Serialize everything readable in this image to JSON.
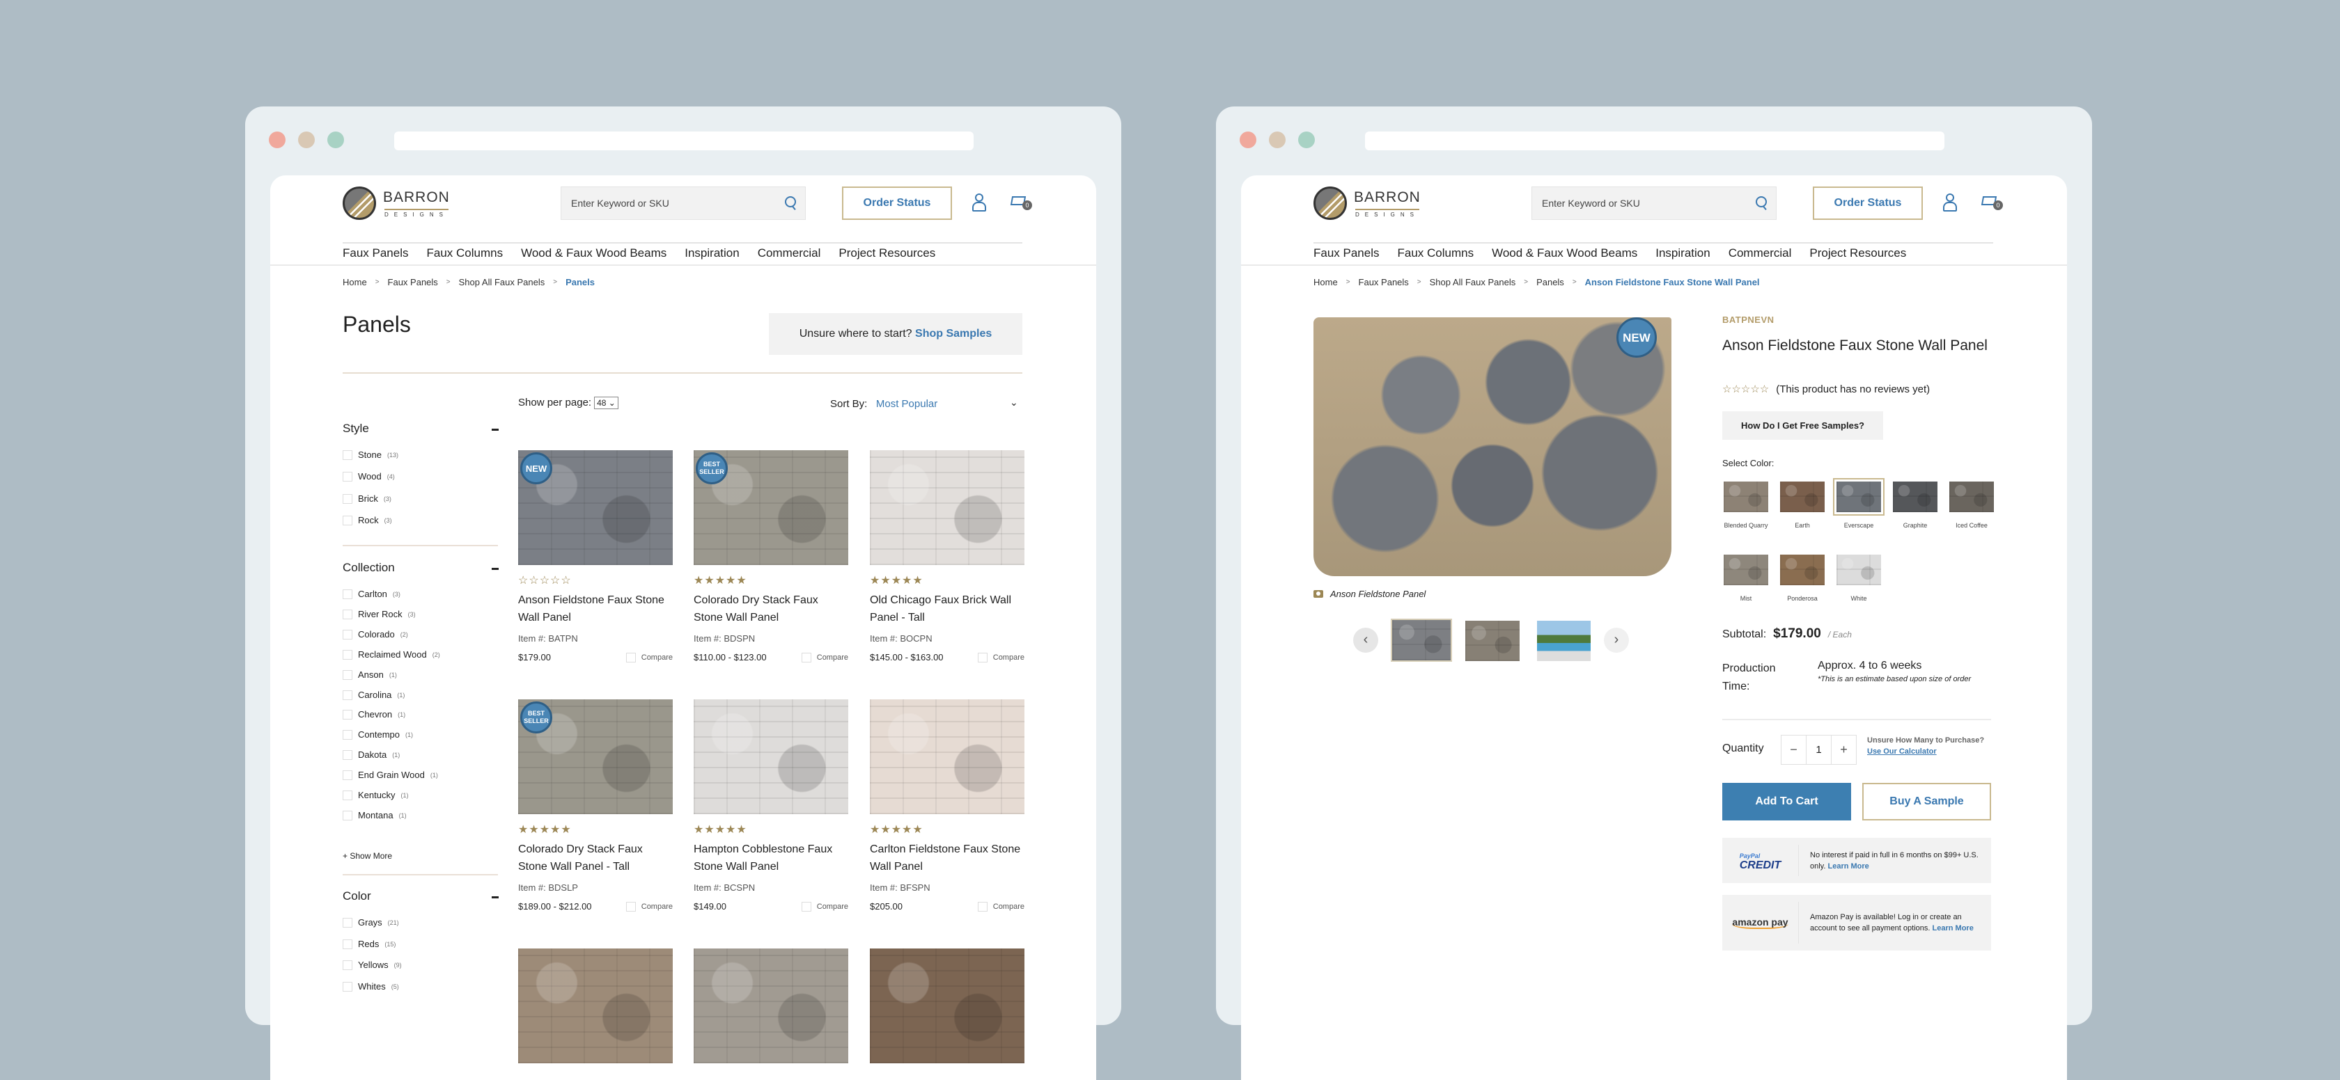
{
  "header": {
    "brand": "BARRON",
    "brand_sub": "DESIGNS",
    "search_placeholder": "Enter Keyword or SKU",
    "order_status": "Order Status",
    "cart_count": "0",
    "nav": [
      "Faux Panels",
      "Faux Columns",
      "Wood & Faux Wood Beams",
      "Inspiration",
      "Commercial",
      "Project Resources"
    ]
  },
  "listing": {
    "breadcrumb": [
      "Home",
      "Faux Panels",
      "Shop All Faux Panels",
      "Panels"
    ],
    "title": "Panels",
    "samples_prompt": "Unsure where to start?",
    "samples_link": "Shop Samples",
    "per_page_label": "Show per page:",
    "per_page_value": "48",
    "sort_label": "Sort By:",
    "sort_value": "Most Popular",
    "filters": [
      {
        "title": "Style",
        "items": [
          {
            "label": "Stone",
            "count": "(13)"
          },
          {
            "label": "Wood",
            "count": "(4)"
          },
          {
            "label": "Brick",
            "count": "(3)"
          },
          {
            "label": "Rock",
            "count": "(3)"
          }
        ]
      },
      {
        "title": "Collection",
        "items": [
          {
            "label": "Carlton",
            "count": "(3)"
          },
          {
            "label": "River Rock",
            "count": "(3)"
          },
          {
            "label": "Colorado",
            "count": "(2)"
          },
          {
            "label": "Reclaimed Wood",
            "count": "(2)"
          },
          {
            "label": "Anson",
            "count": "(1)"
          },
          {
            "label": "Carolina",
            "count": "(1)"
          },
          {
            "label": "Chevron",
            "count": "(1)"
          },
          {
            "label": "Contempo",
            "count": "(1)"
          },
          {
            "label": "Dakota",
            "count": "(1)"
          },
          {
            "label": "End Grain Wood",
            "count": "(1)"
          },
          {
            "label": "Kentucky",
            "count": "(1)"
          },
          {
            "label": "Montana",
            "count": "(1)"
          }
        ],
        "more": "+ Show More"
      },
      {
        "title": "Color",
        "items": [
          {
            "label": "Grays",
            "count": "(21)"
          },
          {
            "label": "Reds",
            "count": "(15)"
          },
          {
            "label": "Yellows",
            "count": "(9)"
          },
          {
            "label": "Whites",
            "count": "(5)"
          }
        ]
      }
    ],
    "compare_label": "Compare",
    "products": [
      {
        "name": "Anson Fieldstone Faux Stone Wall Panel",
        "item": "Item #: BATPN",
        "price": "$179.00",
        "stars": "☆☆☆☆☆",
        "badge": "NEW",
        "color": "#7b7f86"
      },
      {
        "name": "Colorado Dry Stack Faux Stone Wall Panel",
        "item": "Item #: BDSPN",
        "price": "$110.00 - $123.00",
        "stars": "★★★★★",
        "badge": "BEST SELLER",
        "color": "#9b988e"
      },
      {
        "name": "Old Chicago Faux Brick Wall Panel - Tall",
        "item": "Item #: BOCPN",
        "price": "$145.00 - $163.00",
        "stars": "★★★★★",
        "badge": "",
        "color": "#e2dedb"
      },
      {
        "name": "Colorado Dry Stack Faux Stone Wall Panel - Tall",
        "item": "Item #: BDSLP",
        "price": "$189.00 - $212.00",
        "stars": "★★★★★",
        "badge": "BEST SELLER",
        "color": "#9a978c"
      },
      {
        "name": "Hampton Cobblestone Faux Stone Wall Panel",
        "item": "Item #: BCSPN",
        "price": "$149.00",
        "stars": "★★★★★",
        "badge": "",
        "color": "#dedcda"
      },
      {
        "name": "Carlton Fieldstone Faux Stone Wall Panel",
        "item": "Item #: BFSPN",
        "price": "$205.00",
        "stars": "★★★★★",
        "badge": "",
        "color": "#e6dbd3"
      },
      {
        "name": "",
        "item": "",
        "price": "",
        "stars": "",
        "badge": "",
        "color": "#9d8b78"
      },
      {
        "name": "",
        "item": "",
        "price": "",
        "stars": "",
        "badge": "",
        "color": "#a19b92"
      },
      {
        "name": "",
        "item": "",
        "price": "",
        "stars": "",
        "badge": "",
        "color": "#7c6552"
      }
    ]
  },
  "detail": {
    "breadcrumb": [
      "Home",
      "Faux Panels",
      "Shop All Faux Panels",
      "Panels",
      "Anson Fieldstone Faux Stone Wall Panel"
    ],
    "badge": "NEW",
    "caption": "Anson Fieldstone Panel",
    "sku": "BATPNEVN",
    "title": "Anson Fieldstone Faux Stone Wall Panel",
    "stars": "☆☆☆☆☆",
    "reviews": "(This product has no reviews yet)",
    "free_samples": "How Do I Get Free Samples?",
    "select_color": "Select Color:",
    "colors": [
      {
        "name": "Blended Quarry",
        "hex": "#8d8275"
      },
      {
        "name": "Earth",
        "hex": "#7a5f4c"
      },
      {
        "name": "Everscape",
        "hex": "#6f747a",
        "selected": true
      },
      {
        "name": "Graphite",
        "hex": "#55575a"
      },
      {
        "name": "Iced Coffee",
        "hex": "#6a655e"
      },
      {
        "name": "Mist",
        "hex": "#8e877c"
      },
      {
        "name": "Ponderosa",
        "hex": "#8a6d50"
      },
      {
        "name": "White",
        "hex": "#dcdcdc"
      }
    ],
    "subtotal_label": "Subtotal:",
    "subtotal": "$179.00",
    "per": "/ Each",
    "production_label": "Production Time:",
    "production": "Approx. 4 to 6 weeks",
    "production_note": "*This is an estimate based upon size of order",
    "quantity_label": "Quantity",
    "quantity": "1",
    "minus": "−",
    "plus": "+",
    "unsure": "Unsure How Many to Purchase?",
    "calculator": "Use Our Calculator",
    "add_to_cart": "Add To Cart",
    "buy_sample": "Buy A Sample",
    "paypal_top": "PayPal",
    "paypal_bottom": "CREDIT",
    "paypal_text": "No interest if paid in full in 6 months on $99+ U.S. only.",
    "learn_more": "Learn More",
    "amazon_logo": "amazon pay",
    "amazon_text": "Amazon Pay is available! Log in or create an account to see all payment options.",
    "thumb_colors": [
      "#7d7f83",
      "#878075",
      "#5d9ac0"
    ]
  },
  "colors": {
    "accent": "#3d7fb1",
    "gold": "#b39c6a",
    "background": "#aebcc5"
  }
}
